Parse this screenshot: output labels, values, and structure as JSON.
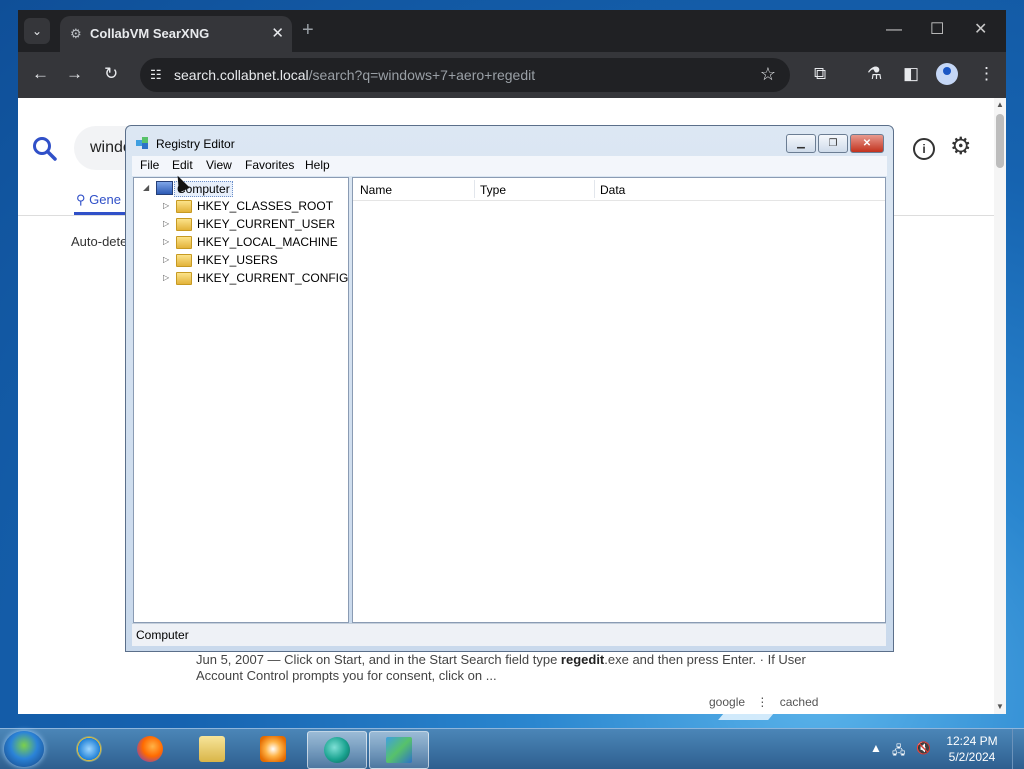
{
  "browser": {
    "tab_title": "CollabVM SearXNG",
    "url_host": "search.collabnet.local",
    "url_path": "/search?q=windows+7+aero+regedit"
  },
  "page": {
    "search_text": "windo",
    "category_tab": "Gene",
    "auto_detect": "Auto-dete",
    "result_snippet_pre": "Jun 5, 2007 — Click on Start, and in the Start Search field type ",
    "result_snippet_bold": "regedit",
    "result_snippet_post": ".exe and then press Enter. · If User Account Control prompts you for consent, click on ...",
    "link_google": "google",
    "link_sep": "⋮",
    "link_cached": "cached"
  },
  "regedit": {
    "title": "Registry Editor",
    "menu": [
      "File",
      "Edit",
      "View",
      "Favorites",
      "Help"
    ],
    "tree_root": "Computer",
    "tree_items": [
      "HKEY_CLASSES_ROOT",
      "HKEY_CURRENT_USER",
      "HKEY_LOCAL_MACHINE",
      "HKEY_USERS",
      "HKEY_CURRENT_CONFIG"
    ],
    "columns": [
      "Name",
      "Type",
      "Data"
    ],
    "status": "Computer"
  },
  "taskbar": {
    "time": "12:24 PM",
    "date": "5/2/2024",
    "apps": [
      "internet-explorer",
      "firefox",
      "file-explorer",
      "media-player",
      "collabvm-browser",
      "registry-editor"
    ]
  }
}
